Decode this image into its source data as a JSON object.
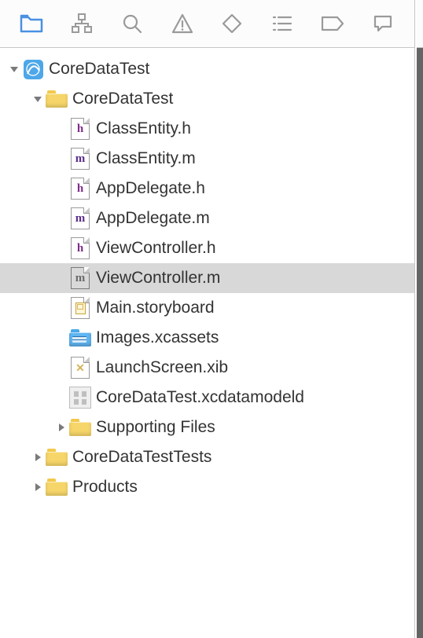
{
  "toolbar": {
    "items": [
      {
        "name": "folder-icon"
      },
      {
        "name": "hierarchy-icon"
      },
      {
        "name": "search-icon"
      },
      {
        "name": "warning-icon"
      },
      {
        "name": "diamond-icon"
      },
      {
        "name": "list-icon"
      },
      {
        "name": "tag-icon"
      },
      {
        "name": "comment-icon"
      }
    ],
    "selected_index": 0
  },
  "tree": {
    "project": {
      "label": "CoreDataTest",
      "expanded": true,
      "icon": "app-icon",
      "children": [
        {
          "label": "CoreDataTest",
          "icon": "folder-yellow",
          "expanded": true,
          "children": [
            {
              "label": "ClassEntity.h",
              "icon": "file-h"
            },
            {
              "label": "ClassEntity.m",
              "icon": "file-m"
            },
            {
              "label": "AppDelegate.h",
              "icon": "file-h"
            },
            {
              "label": "AppDelegate.m",
              "icon": "file-m"
            },
            {
              "label": "ViewController.h",
              "icon": "file-h"
            },
            {
              "label": "ViewController.m",
              "icon": "file-m-grey",
              "selected": true
            },
            {
              "label": "Main.storyboard",
              "icon": "file-storyboard"
            },
            {
              "label": "Images.xcassets",
              "icon": "folder-blue"
            },
            {
              "label": "LaunchScreen.xib",
              "icon": "file-xib"
            },
            {
              "label": "CoreDataTest.xcdatamodeld",
              "icon": "file-datamodel"
            },
            {
              "label": "Supporting Files",
              "icon": "folder-yellow",
              "expanded": false,
              "hasChildren": true
            }
          ]
        },
        {
          "label": "CoreDataTestTests",
          "icon": "folder-yellow",
          "expanded": false,
          "hasChildren": true
        },
        {
          "label": "Products",
          "icon": "folder-yellow",
          "expanded": false,
          "hasChildren": true
        }
      ]
    }
  },
  "colors": {
    "selection": "#d8d8d8",
    "toolbar_active": "#4a90e2"
  }
}
